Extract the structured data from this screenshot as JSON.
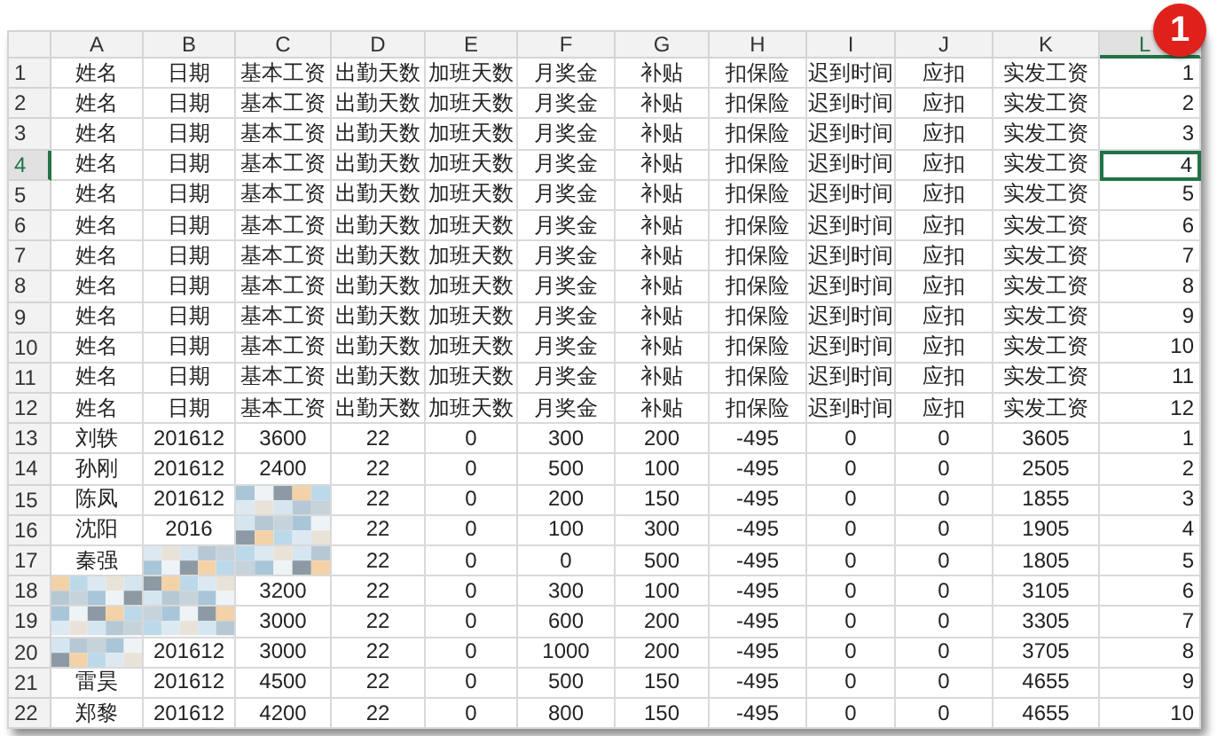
{
  "badge": "1",
  "columns": [
    {
      "label": "A",
      "selected": false
    },
    {
      "label": "B",
      "selected": false
    },
    {
      "label": "C",
      "selected": false
    },
    {
      "label": "D",
      "selected": false
    },
    {
      "label": "E",
      "selected": false
    },
    {
      "label": "F",
      "selected": false
    },
    {
      "label": "G",
      "selected": false
    },
    {
      "label": "H",
      "selected": false
    },
    {
      "label": "I",
      "selected": false
    },
    {
      "label": "J",
      "selected": false
    },
    {
      "label": "K",
      "selected": false
    },
    {
      "label": "L",
      "selected": true
    }
  ],
  "rows": [
    {
      "label": "1",
      "selected": false,
      "cells": [
        "姓名",
        "日期",
        "基本工资",
        "出勤天数",
        "加班天数",
        "月奖金",
        "补贴",
        "扣保险",
        "迟到时间",
        "应扣",
        "实发工资",
        "1"
      ]
    },
    {
      "label": "2",
      "selected": false,
      "cells": [
        "姓名",
        "日期",
        "基本工资",
        "出勤天数",
        "加班天数",
        "月奖金",
        "补贴",
        "扣保险",
        "迟到时间",
        "应扣",
        "实发工资",
        "2"
      ]
    },
    {
      "label": "3",
      "selected": false,
      "cells": [
        "姓名",
        "日期",
        "基本工资",
        "出勤天数",
        "加班天数",
        "月奖金",
        "补贴",
        "扣保险",
        "迟到时间",
        "应扣",
        "实发工资",
        "3"
      ]
    },
    {
      "label": "4",
      "selected": true,
      "cells": [
        "姓名",
        "日期",
        "基本工资",
        "出勤天数",
        "加班天数",
        "月奖金",
        "补贴",
        "扣保险",
        "迟到时间",
        "应扣",
        "实发工资",
        "4"
      ]
    },
    {
      "label": "5",
      "selected": false,
      "cells": [
        "姓名",
        "日期",
        "基本工资",
        "出勤天数",
        "加班天数",
        "月奖金",
        "补贴",
        "扣保险",
        "迟到时间",
        "应扣",
        "实发工资",
        "5"
      ]
    },
    {
      "label": "6",
      "selected": false,
      "cells": [
        "姓名",
        "日期",
        "基本工资",
        "出勤天数",
        "加班天数",
        "月奖金",
        "补贴",
        "扣保险",
        "迟到时间",
        "应扣",
        "实发工资",
        "6"
      ]
    },
    {
      "label": "7",
      "selected": false,
      "cells": [
        "姓名",
        "日期",
        "基本工资",
        "出勤天数",
        "加班天数",
        "月奖金",
        "补贴",
        "扣保险",
        "迟到时间",
        "应扣",
        "实发工资",
        "7"
      ]
    },
    {
      "label": "8",
      "selected": false,
      "cells": [
        "姓名",
        "日期",
        "基本工资",
        "出勤天数",
        "加班天数",
        "月奖金",
        "补贴",
        "扣保险",
        "迟到时间",
        "应扣",
        "实发工资",
        "8"
      ]
    },
    {
      "label": "9",
      "selected": false,
      "cells": [
        "姓名",
        "日期",
        "基本工资",
        "出勤天数",
        "加班天数",
        "月奖金",
        "补贴",
        "扣保险",
        "迟到时间",
        "应扣",
        "实发工资",
        "9"
      ]
    },
    {
      "label": "10",
      "selected": false,
      "cells": [
        "姓名",
        "日期",
        "基本工资",
        "出勤天数",
        "加班天数",
        "月奖金",
        "补贴",
        "扣保险",
        "迟到时间",
        "应扣",
        "实发工资",
        "10"
      ]
    },
    {
      "label": "11",
      "selected": false,
      "cells": [
        "姓名",
        "日期",
        "基本工资",
        "出勤天数",
        "加班天数",
        "月奖金",
        "补贴",
        "扣保险",
        "迟到时间",
        "应扣",
        "实发工资",
        "11"
      ]
    },
    {
      "label": "12",
      "selected": false,
      "cells": [
        "姓名",
        "日期",
        "基本工资",
        "出勤天数",
        "加班天数",
        "月奖金",
        "补贴",
        "扣保险",
        "迟到时间",
        "应扣",
        "实发工资",
        "12"
      ]
    },
    {
      "label": "13",
      "selected": false,
      "cells": [
        "刘轶",
        "201612",
        "3600",
        "22",
        "0",
        "300",
        "200",
        "-495",
        "0",
        "0",
        "3605",
        "1"
      ]
    },
    {
      "label": "14",
      "selected": false,
      "cells": [
        "孙刚",
        "201612",
        "2400",
        "22",
        "0",
        "500",
        "100",
        "-495",
        "0",
        "0",
        "2505",
        "2"
      ]
    },
    {
      "label": "15",
      "selected": false,
      "cells": [
        "陈凤",
        "201612",
        null,
        "22",
        "0",
        "200",
        "150",
        "-495",
        "0",
        "0",
        "1855",
        "3"
      ]
    },
    {
      "label": "16",
      "selected": false,
      "cells": [
        "沈阳",
        "2016",
        null,
        "22",
        "0",
        "100",
        "300",
        "-495",
        "0",
        "0",
        "1905",
        "4"
      ]
    },
    {
      "label": "17",
      "selected": false,
      "cells": [
        "秦强",
        null,
        null,
        "22",
        "0",
        "0",
        "500",
        "-495",
        "0",
        "0",
        "1805",
        "5"
      ]
    },
    {
      "label": "18",
      "selected": false,
      "cells": [
        null,
        null,
        "3200",
        "22",
        "0",
        "300",
        "100",
        "-495",
        "0",
        "0",
        "3105",
        "6"
      ]
    },
    {
      "label": "19",
      "selected": false,
      "cells": [
        null,
        null,
        "3000",
        "22",
        "0",
        "600",
        "200",
        "-495",
        "0",
        "0",
        "3305",
        "7"
      ]
    },
    {
      "label": "20",
      "selected": false,
      "cells": [
        null,
        "201612",
        "3000",
        "22",
        "0",
        "1000",
        "200",
        "-495",
        "0",
        "0",
        "3705",
        "8"
      ]
    },
    {
      "label": "21",
      "selected": false,
      "cells": [
        "雷昊",
        "201612",
        "4500",
        "22",
        "0",
        "500",
        "150",
        "-495",
        "0",
        "0",
        "4655",
        "9"
      ]
    },
    {
      "label": "22",
      "selected": false,
      "cells": [
        "郑黎",
        "201612",
        "4200",
        "22",
        "0",
        "800",
        "150",
        "-495",
        "0",
        "0",
        "4655",
        "10"
      ]
    }
  ]
}
